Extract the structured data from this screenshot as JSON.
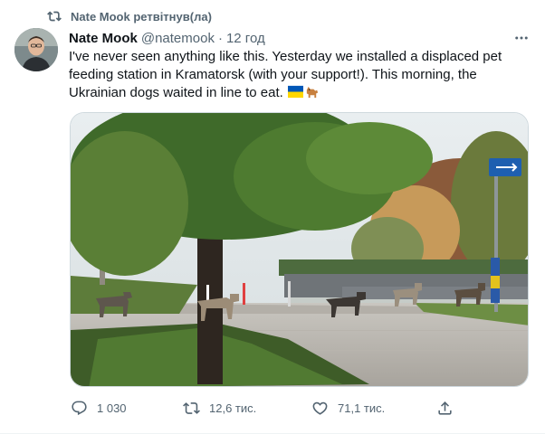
{
  "retweet_context": {
    "label": "Nate Mook ретвітнув(ла)",
    "icon": "retweet-icon"
  },
  "tweet": {
    "author_name": "Nate Mook",
    "author_handle": "@natemook",
    "separator": "·",
    "time": "12 год",
    "text": "I've never seen anything like this. Yesterday we installed a displaced pet feeding station in Kramatorsk (with your support!). This morning, the Ukrainian dogs waited in line to eat.",
    "emojis": [
      "ukraine-flag-emoji",
      "dog-emoji"
    ],
    "more_icon": "more-horizontal-icon"
  },
  "actions": {
    "reply": {
      "icon": "reply-icon",
      "count": "1 030"
    },
    "retweet": {
      "icon": "retweet-icon",
      "count": "12,6 тис."
    },
    "like": {
      "icon": "heart-icon",
      "count": "71,1 тис."
    },
    "share": {
      "icon": "share-icon",
      "count": ""
    }
  },
  "colors": {
    "secondary_text": "#536471",
    "primary_text": "#0f1419",
    "border": "#cfd9de",
    "flag_blue": "#0057b7",
    "flag_yellow": "#ffd700"
  }
}
